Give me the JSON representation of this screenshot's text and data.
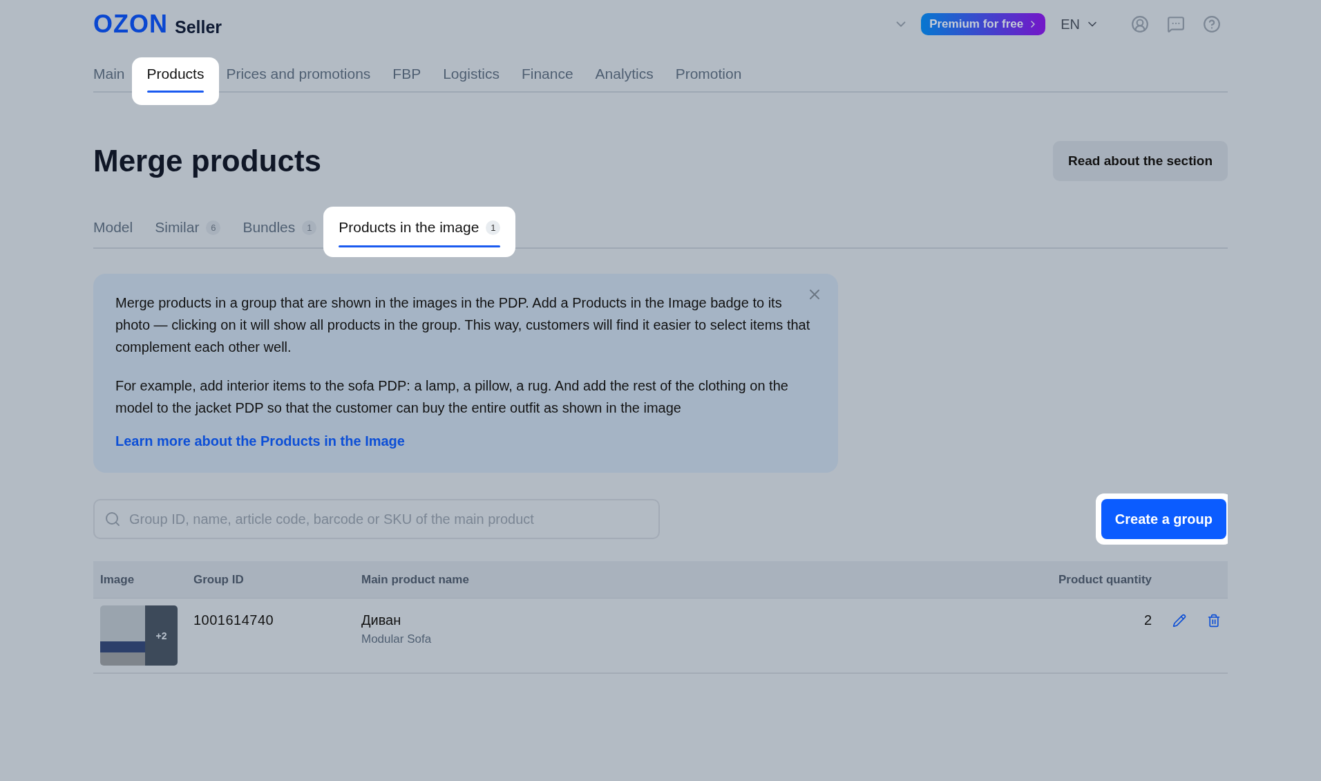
{
  "header": {
    "logo": "OZON",
    "logo_suffix": "Seller",
    "premium": "Premium for free",
    "language": "EN"
  },
  "nav": [
    {
      "label": "Main",
      "selected": false
    },
    {
      "label": "Products",
      "selected": true
    },
    {
      "label": "Prices and promotions",
      "selected": false
    },
    {
      "label": "FBP",
      "selected": false
    },
    {
      "label": "Logistics",
      "selected": false
    },
    {
      "label": "Finance",
      "selected": false
    },
    {
      "label": "Analytics",
      "selected": false
    },
    {
      "label": "Promotion",
      "selected": false
    }
  ],
  "page": {
    "title": "Merge products",
    "help_button": "Read about the section"
  },
  "tabs": [
    {
      "label": "Model",
      "selected": false
    },
    {
      "label": "Similar",
      "count": "6",
      "selected": false
    },
    {
      "label": "Bundles",
      "count": "1",
      "selected": false
    },
    {
      "label": "Products in the image",
      "count": "1",
      "selected": true
    }
  ],
  "info": {
    "paragraphs": [
      "Merge products in a group that are shown in the images in the PDP. Add a Products in the Image badge to its photo — clicking on it will show all products in the group. This way, customers will find it easier to select items that complement each other well.",
      "For example, add interior items to the sofa PDP: a lamp, a pillow, a rug. And add the rest of the clothing on the model to the jacket PDP so that the customer can buy the entire outfit as shown in the image"
    ],
    "link": "Learn more about the Products in the Image"
  },
  "search": {
    "placeholder": "Group ID, name, article code, barcode or SKU of the main product"
  },
  "create_button": "Create a group",
  "table": {
    "columns": [
      "Image",
      "Group ID",
      "Main product name",
      "Product quantity"
    ],
    "rows": [
      {
        "extra_images": "+2",
        "group_id": "1001614740",
        "name": "Диван",
        "subtitle": "Modular Sofa",
        "quantity": "2"
      }
    ]
  }
}
